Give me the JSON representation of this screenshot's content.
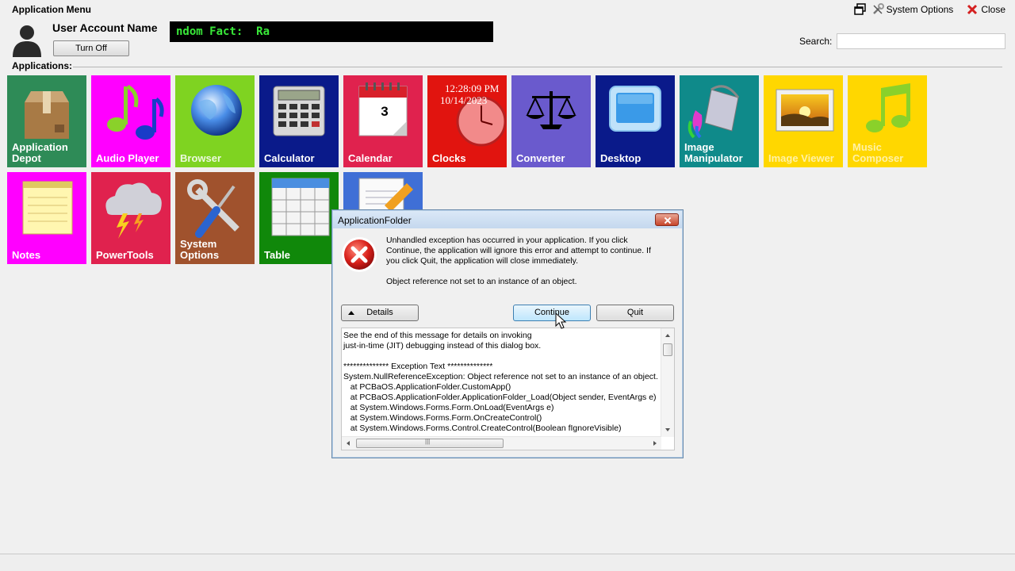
{
  "window": {
    "title": "Application Menu",
    "system_options_label": "System Options",
    "close_label": "Close"
  },
  "user": {
    "account_name": "User Account Name",
    "turn_off_label": "Turn Off"
  },
  "fact_banner": {
    "text": "ndom Fact:  Ra",
    "text_color": "#39e839",
    "background": "#000000"
  },
  "search": {
    "label": "Search:",
    "value": "",
    "placeholder": ""
  },
  "applications": {
    "label": "Applications:",
    "tiles": [
      {
        "label": "Application Depot",
        "color": "#2e8b57",
        "icon": "package-box-icon"
      },
      {
        "label": "Audio Player",
        "color": "#ff00ff",
        "icon": "music-notes-icon"
      },
      {
        "label": "Browser",
        "color": "#7fd321",
        "icon": "globe-icon"
      },
      {
        "label": "Calculator",
        "color": "#0a1a8a",
        "icon": "calculator-icon"
      },
      {
        "label": "Calendar",
        "color": "#e0224e",
        "icon": "calendar-icon",
        "calendar_day": "3"
      },
      {
        "label": "Clocks",
        "color": "#e1140f",
        "icon": "clock-icon",
        "time": "12:28:09 PM",
        "date": "10/14/2023"
      },
      {
        "label": "Converter",
        "color": "#6a5acd",
        "icon": "scales-icon"
      },
      {
        "label": "Desktop",
        "color": "#0a1a8a",
        "icon": "monitor-icon"
      },
      {
        "label": "Image Manipulator",
        "color": "#0f8a8a",
        "icon": "paint-bucket-icon"
      },
      {
        "label": "Image Viewer",
        "color": "#ffd700",
        "icon": "picture-icon"
      },
      {
        "label": "Music Composer",
        "color": "#ffd700",
        "icon": "music-note-icon"
      },
      {
        "label": "Notes",
        "color": "#ff00ff",
        "icon": "notepad-icon"
      },
      {
        "label": "PowerTools",
        "color": "#e0224e",
        "icon": "storm-cloud-icon"
      },
      {
        "label": "System Options",
        "color": "#a0522d",
        "icon": "wrench-screwdriver-icon"
      },
      {
        "label": "Table",
        "color": "#10880a",
        "icon": "table-grid-icon"
      },
      {
        "label": "",
        "color": "#3f6fd6",
        "icon": "document-pencil-icon"
      }
    ]
  },
  "dialog": {
    "title": "ApplicationFolder",
    "message": "Unhandled exception has occurred in your application. If you click Continue, the application will ignore this error and attempt to continue. If you click Quit, the application will close immediately.",
    "detail_message": "Object reference not set to an instance of an object.",
    "details_button": "Details",
    "continue_button": "Continue",
    "quit_button": "Quit",
    "details_text": "See the end of this message for details on invoking\njust-in-time (JIT) debugging instead of this dialog box.\n\n************** Exception Text **************\nSystem.NullReferenceException: Object reference not set to an instance of an object.\n   at PCBaOS.ApplicationFolder.CustomApp()\n   at PCBaOS.ApplicationFolder.ApplicationFolder_Load(Object sender, EventArgs e)\n   at System.Windows.Forms.Form.OnLoad(EventArgs e)\n   at System.Windows.Forms.Form.OnCreateControl()\n   at System.Windows.Forms.Control.CreateControl(Boolean fIgnoreVisible)"
  }
}
